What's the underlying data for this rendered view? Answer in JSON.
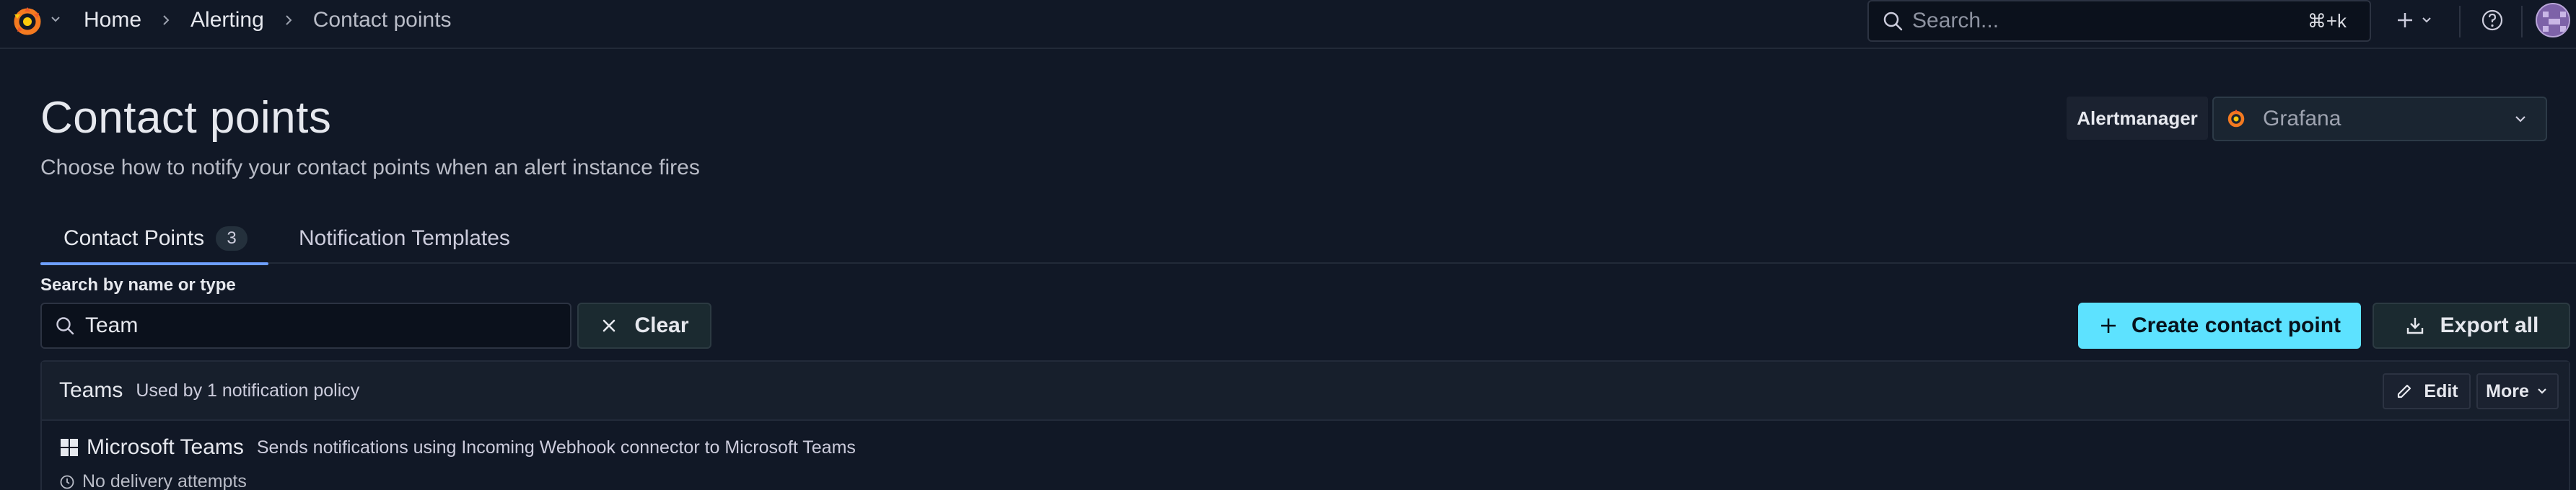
{
  "topbar": {
    "logo_icon": "grafana-logo-icon",
    "breadcrumb": [
      "Home",
      "Alerting",
      "Contact points"
    ],
    "search": {
      "placeholder": "Search...",
      "shortcut": "⌘+k"
    },
    "add_icon": "plus-icon",
    "help_icon": "help-circle-icon",
    "avatar_icon": "user-avatar"
  },
  "page": {
    "title": "Contact points",
    "subtitle": "Choose how to notify your contact points when an alert instance fires"
  },
  "alertmanager": {
    "label": "Alertmanager",
    "selected": "Grafana"
  },
  "tabs": [
    {
      "label": "Contact Points",
      "counter": "3",
      "active": true
    },
    {
      "label": "Notification Templates",
      "active": false
    }
  ],
  "filter": {
    "label": "Search by name or type",
    "value": "Team",
    "clear_label": "Clear"
  },
  "actions": {
    "create_label": "Create contact point",
    "export_label": "Export all"
  },
  "contact_points": [
    {
      "name": "Teams",
      "meta": "Used by 1 notification policy",
      "edit_label": "Edit",
      "more_label": "More",
      "integration": {
        "name": "Microsoft Teams",
        "description": "Sends notifications using Incoming Webhook connector to Microsoft Teams",
        "icon": "microsoft-teams-icon"
      },
      "delivery_status": "No delivery attempts"
    }
  ],
  "colors": {
    "background": "#111826",
    "primary": "#5de2ff",
    "tab_underline": "#6e9fff",
    "grafana_orange": "#f05a28"
  }
}
